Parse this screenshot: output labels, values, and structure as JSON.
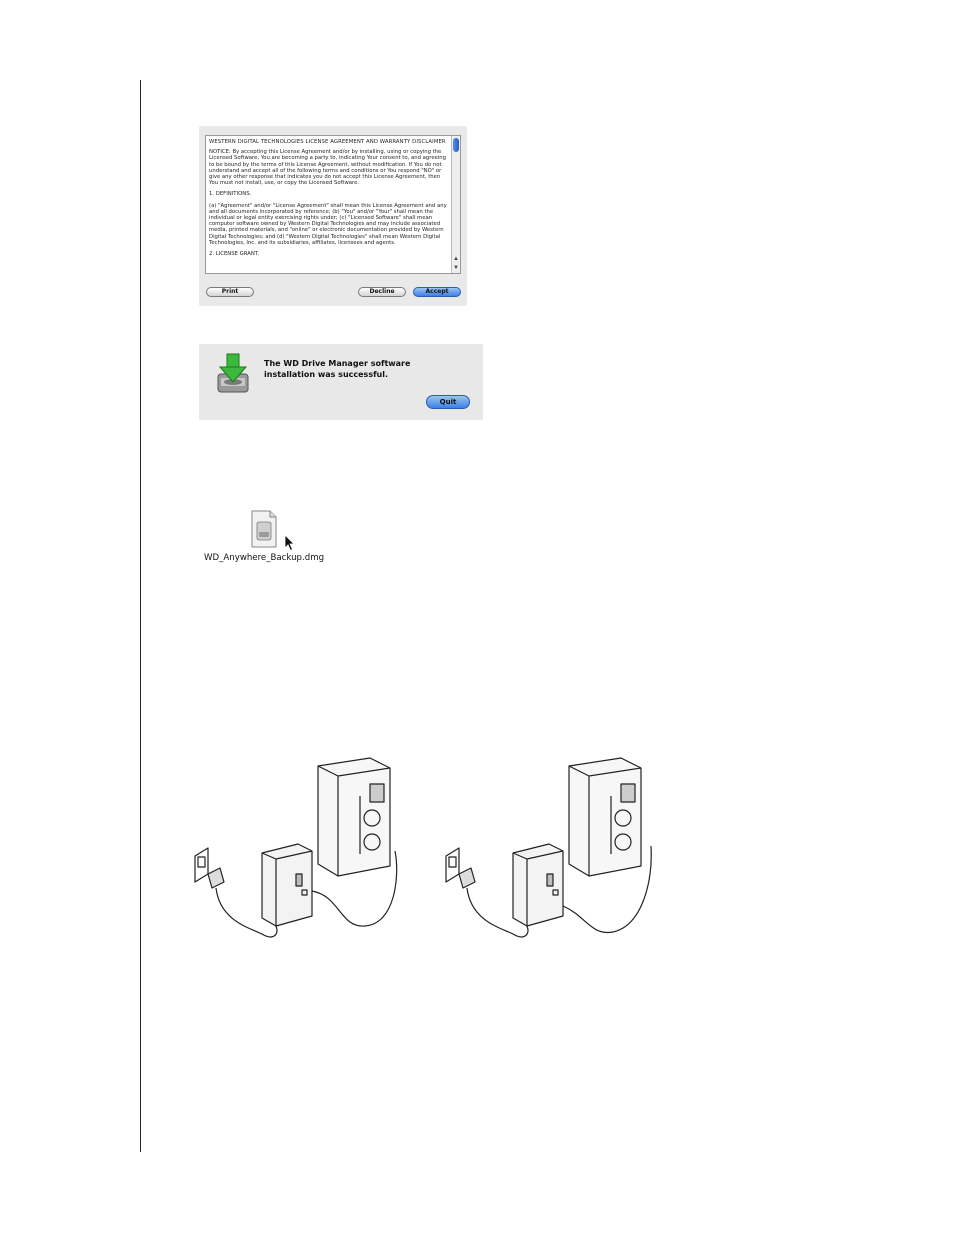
{
  "license_dialog": {
    "title": "WESTERN DIGITAL TECHNOLOGIES LICENSE AGREEMENT AND WARRANTY DISCLAIMER",
    "paragraphs": [
      "NOTICE: By accepting this License Agreement and/or by installing, using or copying the Licensed Software, You are becoming a party to, indicating Your consent to, and agreeing to be bound by the terms of this License Agreement, without modification. If You do not understand and accept all of the following terms and conditions or You respond \"NO\" or give any other response that indicates you do not accept this License Agreement, then You must not install, use, or copy the Licensed Software.",
      "1. DEFINITIONS.",
      "(a) \"Agreement\" and/or \"License Agreement\" shall mean this License Agreement and any and all documents incorporated by reference; (b) \"You\" and/or \"Your\" shall mean the individual or legal entity exercising rights under; (c) \"Licensed Software\" shall mean computer software owned by Western Digital Technologies and may include associated media, printed materials, and \"online\" or electronic documentation provided by Western Digital Technologies; and (d) \"Western Digital Technologies\" shall mean Western Digital Technologies, Inc. and its subsidiaries, affiliates, licensees and agents.",
      "2. LICENSE GRANT."
    ],
    "buttons": {
      "print": "Print",
      "decline": "Decline",
      "accept": "Accept"
    }
  },
  "success_dialog": {
    "message": "The WD Drive Manager software installation was successful.",
    "quit_label": "Quit"
  },
  "dmg_file": {
    "name": "WD_Anywhere_Backup.dmg"
  },
  "colors": {
    "accent_blue": "#3a82e6",
    "dialog_bg": "#e8e8e8",
    "install_arrow_green": "#3cb83c"
  }
}
